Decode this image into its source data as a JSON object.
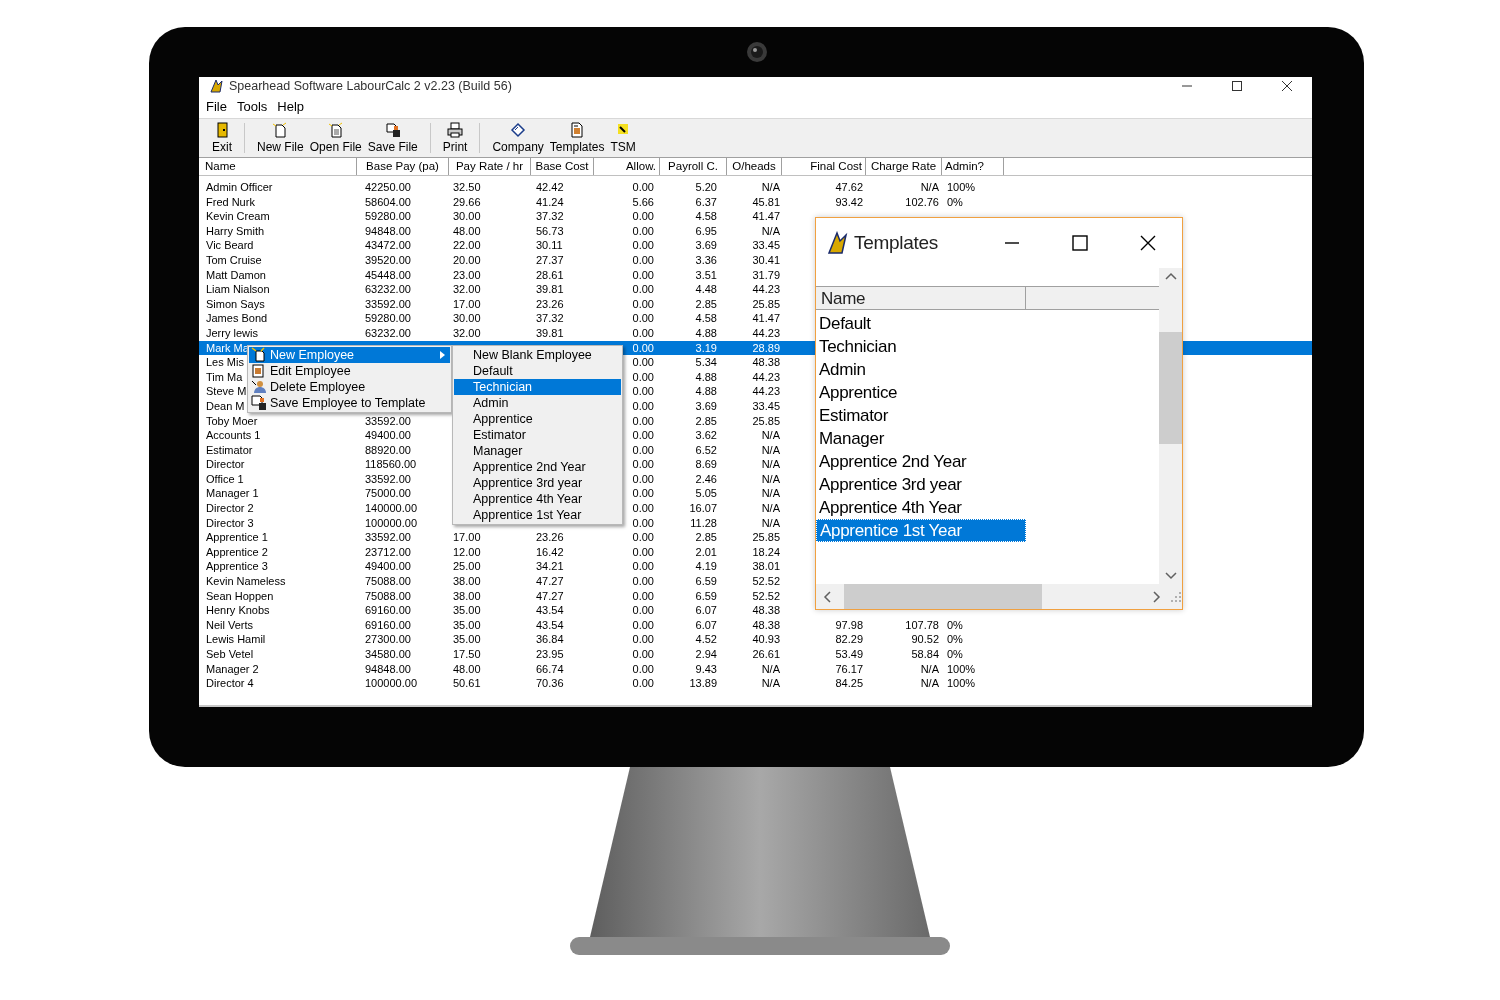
{
  "window": {
    "title": "Spearhead Software LabourCalc 2 v2.23 (Build 56)",
    "menu": [
      "File",
      "Tools",
      "Help"
    ],
    "toolbar": [
      {
        "label": "Exit",
        "separator_after": true
      },
      {
        "label": "New File",
        "separator_after": false
      },
      {
        "label": "Open File",
        "separator_after": false
      },
      {
        "label": "Save File",
        "separator_after": true
      },
      {
        "label": "Print",
        "separator_after": true
      },
      {
        "label": "Company",
        "separator_after": false
      },
      {
        "label": "Templates",
        "separator_after": false
      },
      {
        "label": "TSM",
        "separator_after": false
      }
    ]
  },
  "table": {
    "columns": [
      "Name",
      "Base Pay (pa)",
      "Pay Rate / hr",
      "Base Cost",
      "Allow.",
      "Payroll C.",
      "O/heads",
      "Final Cost",
      "Charge Rate",
      "Admin?"
    ],
    "rows": [
      {
        "selected": false,
        "cells": [
          "Admin Officer",
          "42250.00",
          "32.50",
          "42.42",
          "0.00",
          "5.20",
          "N/A",
          "47.62",
          "N/A",
          "100%"
        ]
      },
      {
        "selected": false,
        "cells": [
          "Fred Nurk",
          "58604.00",
          "29.66",
          "41.24",
          "5.66",
          "6.37",
          "45.81",
          "93.42",
          "102.76",
          "0%"
        ]
      },
      {
        "selected": false,
        "cells": [
          "Kevin Cream",
          "59280.00",
          "30.00",
          "37.32",
          "0.00",
          "4.58",
          "41.47",
          null,
          null,
          null
        ]
      },
      {
        "selected": false,
        "cells": [
          "Harry Smith",
          "94848.00",
          "48.00",
          "56.73",
          "0.00",
          "6.95",
          "N/A",
          null,
          null,
          null
        ]
      },
      {
        "selected": false,
        "cells": [
          "Vic Beard",
          "43472.00",
          "22.00",
          "30.11",
          "0.00",
          "3.69",
          "33.45",
          null,
          null,
          null
        ]
      },
      {
        "selected": false,
        "cells": [
          "Tom Cruise",
          "39520.00",
          "20.00",
          "27.37",
          "0.00",
          "3.36",
          "30.41",
          null,
          null,
          null
        ]
      },
      {
        "selected": false,
        "cells": [
          "Matt Damon",
          "45448.00",
          "23.00",
          "28.61",
          "0.00",
          "3.51",
          "31.79",
          null,
          null,
          null
        ]
      },
      {
        "selected": false,
        "cells": [
          "Liam Nialson",
          "63232.00",
          "32.00",
          "39.81",
          "0.00",
          "4.48",
          "44.23",
          null,
          null,
          null
        ]
      },
      {
        "selected": false,
        "cells": [
          "Simon Says",
          "33592.00",
          "17.00",
          "23.26",
          "0.00",
          "2.85",
          "25.85",
          null,
          null,
          null
        ]
      },
      {
        "selected": false,
        "cells": [
          "James Bond",
          "59280.00",
          "30.00",
          "37.32",
          "0.00",
          "4.58",
          "41.47",
          null,
          null,
          null
        ]
      },
      {
        "selected": false,
        "cells": [
          "Jerry lewis",
          "63232.00",
          "32.00",
          "39.81",
          "0.00",
          "4.88",
          "44.23",
          null,
          null,
          null
        ]
      },
      {
        "selected": true,
        "cells": [
          "Mark Ma",
          null,
          null,
          null,
          "0.00",
          "3.19",
          "28.89",
          null,
          null,
          null
        ]
      },
      {
        "selected": false,
        "cells": [
          "Les Mis",
          null,
          null,
          null,
          "0.00",
          "5.34",
          "48.38",
          null,
          null,
          null
        ]
      },
      {
        "selected": false,
        "cells": [
          "Tim Ma",
          null,
          null,
          null,
          "0.00",
          "4.88",
          "44.23",
          null,
          null,
          null
        ]
      },
      {
        "selected": false,
        "cells": [
          "Steve M",
          null,
          null,
          null,
          "0.00",
          "4.88",
          "44.23",
          null,
          null,
          null
        ]
      },
      {
        "selected": false,
        "cells": [
          "Dean M",
          null,
          null,
          null,
          "0.00",
          "3.69",
          "33.45",
          null,
          null,
          null
        ]
      },
      {
        "selected": false,
        "cells": [
          "Toby Moer",
          "33592.00",
          null,
          null,
          "0.00",
          "2.85",
          "25.85",
          null,
          null,
          null
        ]
      },
      {
        "selected": false,
        "cells": [
          "Accounts 1",
          "49400.00",
          null,
          null,
          "0.00",
          "3.62",
          "N/A",
          null,
          null,
          null
        ]
      },
      {
        "selected": false,
        "cells": [
          "Estimator",
          "88920.00",
          null,
          null,
          "0.00",
          "6.52",
          "N/A",
          null,
          null,
          null
        ]
      },
      {
        "selected": false,
        "cells": [
          "Director",
          "118560.00",
          null,
          null,
          "0.00",
          "8.69",
          "N/A",
          null,
          null,
          null
        ]
      },
      {
        "selected": false,
        "cells": [
          "Office 1",
          "33592.00",
          null,
          null,
          "0.00",
          "2.46",
          "N/A",
          null,
          null,
          null
        ]
      },
      {
        "selected": false,
        "cells": [
          "Manager 1",
          "75000.00",
          null,
          null,
          "0.00",
          "5.05",
          "N/A",
          null,
          null,
          null
        ]
      },
      {
        "selected": false,
        "cells": [
          "Director 2",
          "140000.00",
          null,
          null,
          "0.00",
          "16.07",
          "N/A",
          null,
          null,
          null
        ]
      },
      {
        "selected": false,
        "cells": [
          "Director 3",
          "100000.00",
          null,
          null,
          "0.00",
          "11.28",
          "N/A",
          null,
          null,
          null
        ]
      },
      {
        "selected": false,
        "cells": [
          "Apprentice 1",
          "33592.00",
          "17.00",
          "23.26",
          "0.00",
          "2.85",
          "25.85",
          null,
          null,
          null
        ]
      },
      {
        "selected": false,
        "cells": [
          "Apprentice 2",
          "23712.00",
          "12.00",
          "16.42",
          "0.00",
          "2.01",
          "18.24",
          null,
          null,
          null
        ]
      },
      {
        "selected": false,
        "cells": [
          "Apprentice 3",
          "49400.00",
          "25.00",
          "34.21",
          "0.00",
          "4.19",
          "38.01",
          null,
          null,
          null
        ]
      },
      {
        "selected": false,
        "cells": [
          "Kevin Nameless",
          "75088.00",
          "38.00",
          "47.27",
          "0.00",
          "6.59",
          "52.52",
          null,
          null,
          null
        ]
      },
      {
        "selected": false,
        "cells": [
          "Sean Hoppen",
          "75088.00",
          "38.00",
          "47.27",
          "0.00",
          "6.59",
          "52.52",
          null,
          null,
          null
        ]
      },
      {
        "selected": false,
        "cells": [
          "Henry Knobs",
          "69160.00",
          "35.00",
          "43.54",
          "0.00",
          "6.07",
          "48.38",
          null,
          null,
          null
        ]
      },
      {
        "selected": false,
        "cells": [
          "Neil Verts",
          "69160.00",
          "35.00",
          "43.54",
          "0.00",
          "6.07",
          "48.38",
          "97.98",
          "107.78",
          "0%"
        ]
      },
      {
        "selected": false,
        "cells": [
          "Lewis Hamil",
          "27300.00",
          "35.00",
          "36.84",
          "0.00",
          "4.52",
          "40.93",
          "82.29",
          "90.52",
          "0%"
        ]
      },
      {
        "selected": false,
        "cells": [
          "Seb Vetel",
          "34580.00",
          "17.50",
          "23.95",
          "0.00",
          "2.94",
          "26.61",
          "53.49",
          "58.84",
          "0%"
        ]
      },
      {
        "selected": false,
        "cells": [
          "Manager 2",
          "94848.00",
          "48.00",
          "66.74",
          "0.00",
          "9.43",
          "N/A",
          "76.17",
          "N/A",
          "100%"
        ]
      },
      {
        "selected": false,
        "cells": [
          "Director 4",
          "100000.00",
          "50.61",
          "70.36",
          "0.00",
          "13.89",
          "N/A",
          "84.25",
          "N/A",
          "100%"
        ]
      }
    ]
  },
  "context_menu": {
    "items": [
      {
        "label": "New Employee",
        "selected": true,
        "has_submenu": true
      },
      {
        "label": "Edit Employee",
        "selected": false,
        "has_submenu": false
      },
      {
        "label": "Delete Employee",
        "selected": false,
        "has_submenu": false
      },
      {
        "label": "Save Employee to Template",
        "selected": false,
        "has_submenu": false
      }
    ]
  },
  "submenu": {
    "items": [
      {
        "label": "New Blank Employee",
        "selected": false
      },
      {
        "label": "Default",
        "selected": false
      },
      {
        "label": "Technician",
        "selected": true
      },
      {
        "label": "Admin",
        "selected": false
      },
      {
        "label": "Apprentice",
        "selected": false
      },
      {
        "label": "Estimator",
        "selected": false
      },
      {
        "label": "Manager",
        "selected": false
      },
      {
        "label": "Apprentice 2nd Year",
        "selected": false
      },
      {
        "label": "Apprentice 3rd year",
        "selected": false
      },
      {
        "label": "Apprentice 4th Year",
        "selected": false
      },
      {
        "label": "Apprentice 1st Year",
        "selected": false
      }
    ]
  },
  "templates_window": {
    "title": "Templates",
    "column": "Name",
    "items": [
      {
        "label": "Default",
        "selected": false
      },
      {
        "label": "Technician",
        "selected": false
      },
      {
        "label": "Admin",
        "selected": false
      },
      {
        "label": "Apprentice",
        "selected": false
      },
      {
        "label": "Estimator",
        "selected": false
      },
      {
        "label": "Manager",
        "selected": false
      },
      {
        "label": "Apprentice 2nd Year",
        "selected": false
      },
      {
        "label": "Apprentice 3rd year",
        "selected": false
      },
      {
        "label": "Apprentice 4th Year",
        "selected": false
      },
      {
        "label": "Apprentice 1st Year",
        "selected": true
      }
    ]
  }
}
